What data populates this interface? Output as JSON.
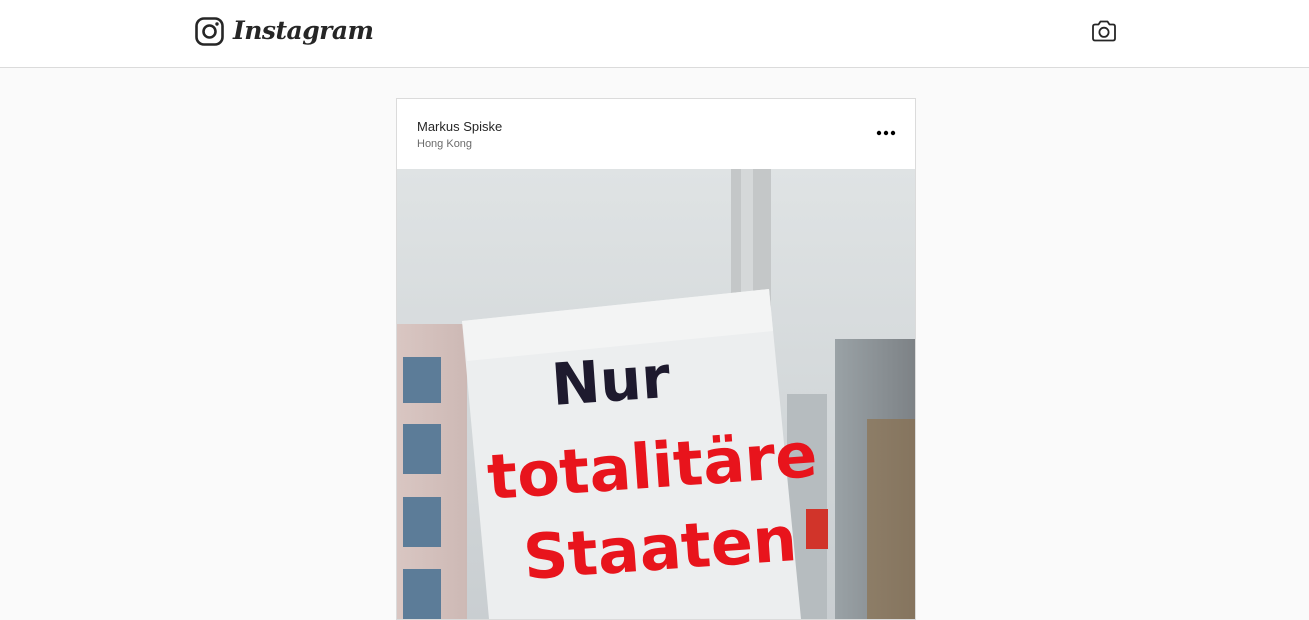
{
  "header": {
    "brand_name": "Instagram",
    "logo_icon": "instagram-glyph-icon",
    "camera_icon": "camera-icon"
  },
  "post": {
    "author": "Markus Spiske",
    "location": "Hong Kong",
    "more_icon": "more-options-icon",
    "photo": {
      "sign_lines": [
        "Nur",
        "totalitäre",
        "Staaten"
      ],
      "sign_colors": {
        "line1": "#1e1a2e",
        "line2": "#e8141c",
        "line3": "#e8141c"
      }
    }
  }
}
